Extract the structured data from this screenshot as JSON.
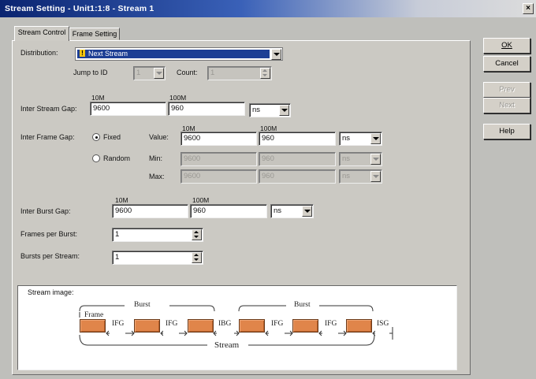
{
  "window": {
    "title": "Stream Setting - Unit1:1:8 - Stream 1",
    "close_glyph": "×"
  },
  "tabs": [
    {
      "label": "Stream Control"
    },
    {
      "label": "Frame Setting"
    }
  ],
  "buttons": {
    "ok": "OK",
    "cancel": "Cancel",
    "prev": "Prev",
    "next": "Next",
    "help": "Help"
  },
  "distribution": {
    "label": "Distribution:",
    "value": "Next Stream",
    "icon_glyph": "!"
  },
  "jump": {
    "label": "Jump to ID",
    "value": "1",
    "count_label": "Count:",
    "count_value": "1"
  },
  "isg": {
    "label": "Inter Stream Gap:",
    "col_10m": "10M",
    "col_100m": "100M",
    "val_10m": "9600",
    "val_100m": "960",
    "unit": "ns"
  },
  "ifg": {
    "label": "Inter Frame Gap:",
    "fixed_label": "Fixed",
    "random_label": "Random",
    "value_label": "Value:",
    "min_label": "Min:",
    "max_label": "Max:",
    "col_10m": "10M",
    "col_100m": "100M",
    "val_10m": "9600",
    "val_100m": "960",
    "unit": "ns",
    "min_10m": "9600",
    "min_100m": "960",
    "min_unit": "ns",
    "max_10m": "9600",
    "max_100m": "960",
    "max_unit": "ns"
  },
  "ibg": {
    "label": "Inter Burst Gap:",
    "col_10m": "10M",
    "col_100m": "100M",
    "val_10m": "9600",
    "val_100m": "960",
    "unit": "ns"
  },
  "frames_per_burst": {
    "label": "Frames per Burst:",
    "value": "1"
  },
  "bursts_per_stream": {
    "label": "Bursts per Stream:",
    "value": "1"
  },
  "stream_image": {
    "label": "Stream image:",
    "frame_label": "Frame",
    "burst_label": "Burst",
    "stream_label": "Stream",
    "ifg": "IFG",
    "ibg": "IBG",
    "isg": "ISG"
  }
}
